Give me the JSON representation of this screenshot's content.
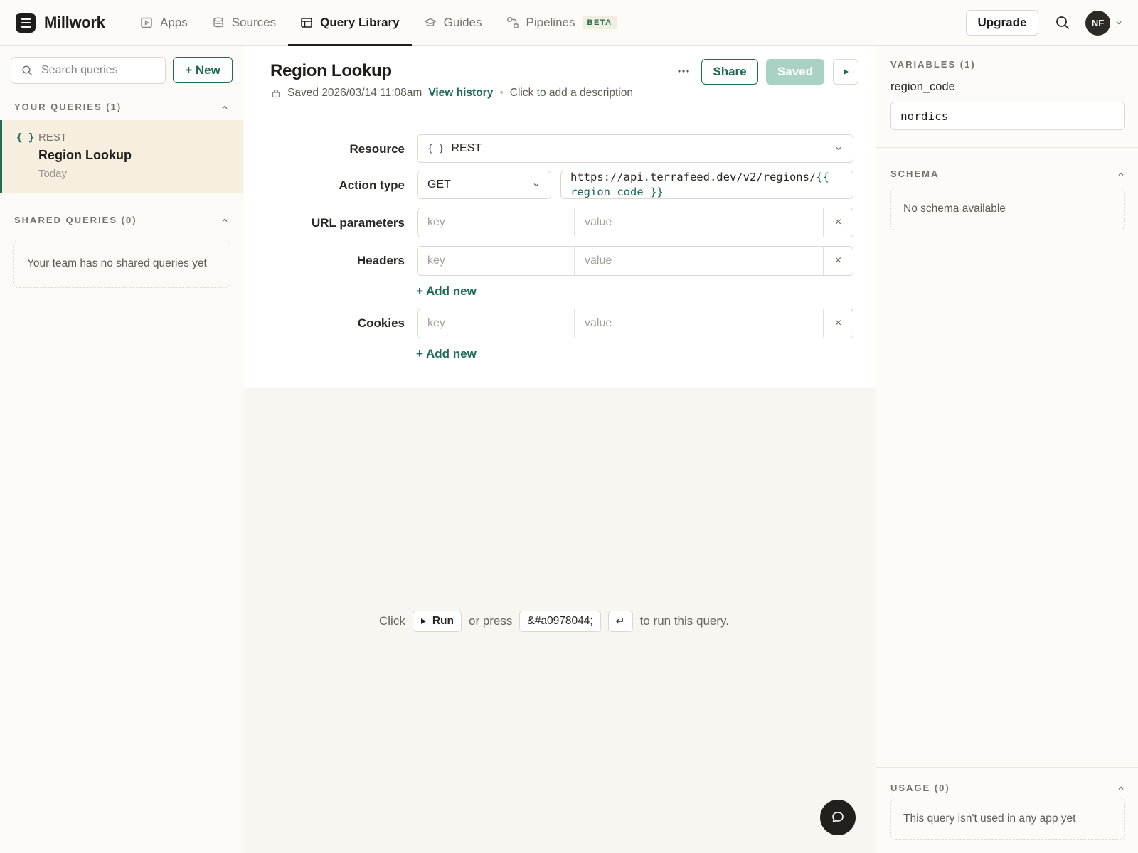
{
  "app": {
    "name": "Millwork"
  },
  "nav": {
    "items": [
      {
        "label": "Apps",
        "icon": "play-square-icon"
      },
      {
        "label": "Sources",
        "icon": "database-icon"
      },
      {
        "label": "Query Library",
        "icon": "table-icon",
        "active": true
      },
      {
        "label": "Guides",
        "icon": "graduation-cap-icon"
      },
      {
        "label": "Pipelines",
        "icon": "workflow-icon",
        "badge": "BETA"
      }
    ],
    "upgrade_label": "Upgrade",
    "avatar_initials": "NF"
  },
  "sidebar": {
    "search_placeholder": "Search queries",
    "new_label": "+ New",
    "your_queries_title": "YOUR QUERIES (1)",
    "queries": [
      {
        "type_icon": "{ }",
        "type": "REST",
        "name": "Region Lookup",
        "time": "Today"
      }
    ],
    "shared_title": "SHARED QUERIES (0)",
    "shared_empty": "Your team has no shared queries yet"
  },
  "query": {
    "title": "Region Lookup",
    "saved_text": "Saved 2026/03/14 11:08am",
    "view_history": "View history",
    "description_placeholder": "Click to add a description",
    "share_label": "Share",
    "saved_label": "Saved",
    "resource_label": "Resource",
    "resource_icon": "{ }",
    "resource_value": "REST",
    "action_label": "Action type",
    "method": "GET",
    "url_prefix": "https://api.terrafeed.dev/v2/regions/",
    "url_open": "{{",
    "url_var": "region_code }}",
    "url_params_label": "URL parameters",
    "headers_label": "Headers",
    "cookies_label": "Cookies",
    "key_placeholder": "key",
    "value_placeholder": "value",
    "remove_glyph": "×",
    "add_new_label": "+ Add new"
  },
  "run_hint": {
    "click": "Click",
    "run_label": "Run",
    "or_press": "or press",
    "shortcut": "&#a0978044;",
    "enter_glyph": "↵",
    "suffix": "to run this query."
  },
  "right_panel": {
    "variables_title": "VARIABLES (1)",
    "variable_name": "region_code",
    "variable_value": "nordics",
    "schema_title": "SCHEMA",
    "schema_empty": "No schema available",
    "usage_title": "USAGE (0)",
    "usage_empty": "This query isn't used in any app yet"
  },
  "colors": {
    "accent": "#1f6b55",
    "selected_bg": "#f6efdf",
    "saved_button": "#a9d1c4"
  }
}
